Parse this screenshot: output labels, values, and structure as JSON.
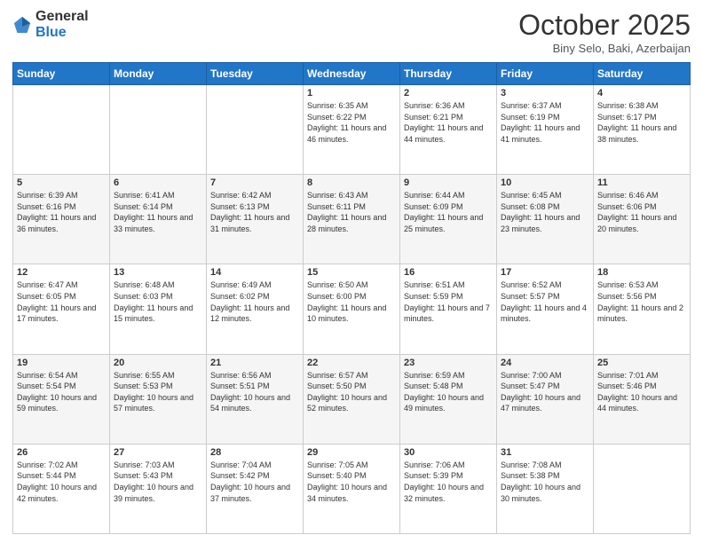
{
  "header": {
    "logo_general": "General",
    "logo_blue": "Blue",
    "month_title": "October 2025",
    "location": "Biny Selo, Baki, Azerbaijan"
  },
  "days_of_week": [
    "Sunday",
    "Monday",
    "Tuesday",
    "Wednesday",
    "Thursday",
    "Friday",
    "Saturday"
  ],
  "weeks": [
    [
      {
        "day": "",
        "info": ""
      },
      {
        "day": "",
        "info": ""
      },
      {
        "day": "",
        "info": ""
      },
      {
        "day": "1",
        "info": "Sunrise: 6:35 AM\nSunset: 6:22 PM\nDaylight: 11 hours and 46 minutes."
      },
      {
        "day": "2",
        "info": "Sunrise: 6:36 AM\nSunset: 6:21 PM\nDaylight: 11 hours and 44 minutes."
      },
      {
        "day": "3",
        "info": "Sunrise: 6:37 AM\nSunset: 6:19 PM\nDaylight: 11 hours and 41 minutes."
      },
      {
        "day": "4",
        "info": "Sunrise: 6:38 AM\nSunset: 6:17 PM\nDaylight: 11 hours and 38 minutes."
      }
    ],
    [
      {
        "day": "5",
        "info": "Sunrise: 6:39 AM\nSunset: 6:16 PM\nDaylight: 11 hours and 36 minutes."
      },
      {
        "day": "6",
        "info": "Sunrise: 6:41 AM\nSunset: 6:14 PM\nDaylight: 11 hours and 33 minutes."
      },
      {
        "day": "7",
        "info": "Sunrise: 6:42 AM\nSunset: 6:13 PM\nDaylight: 11 hours and 31 minutes."
      },
      {
        "day": "8",
        "info": "Sunrise: 6:43 AM\nSunset: 6:11 PM\nDaylight: 11 hours and 28 minutes."
      },
      {
        "day": "9",
        "info": "Sunrise: 6:44 AM\nSunset: 6:09 PM\nDaylight: 11 hours and 25 minutes."
      },
      {
        "day": "10",
        "info": "Sunrise: 6:45 AM\nSunset: 6:08 PM\nDaylight: 11 hours and 23 minutes."
      },
      {
        "day": "11",
        "info": "Sunrise: 6:46 AM\nSunset: 6:06 PM\nDaylight: 11 hours and 20 minutes."
      }
    ],
    [
      {
        "day": "12",
        "info": "Sunrise: 6:47 AM\nSunset: 6:05 PM\nDaylight: 11 hours and 17 minutes."
      },
      {
        "day": "13",
        "info": "Sunrise: 6:48 AM\nSunset: 6:03 PM\nDaylight: 11 hours and 15 minutes."
      },
      {
        "day": "14",
        "info": "Sunrise: 6:49 AM\nSunset: 6:02 PM\nDaylight: 11 hours and 12 minutes."
      },
      {
        "day": "15",
        "info": "Sunrise: 6:50 AM\nSunset: 6:00 PM\nDaylight: 11 hours and 10 minutes."
      },
      {
        "day": "16",
        "info": "Sunrise: 6:51 AM\nSunset: 5:59 PM\nDaylight: 11 hours and 7 minutes."
      },
      {
        "day": "17",
        "info": "Sunrise: 6:52 AM\nSunset: 5:57 PM\nDaylight: 11 hours and 4 minutes."
      },
      {
        "day": "18",
        "info": "Sunrise: 6:53 AM\nSunset: 5:56 PM\nDaylight: 11 hours and 2 minutes."
      }
    ],
    [
      {
        "day": "19",
        "info": "Sunrise: 6:54 AM\nSunset: 5:54 PM\nDaylight: 10 hours and 59 minutes."
      },
      {
        "day": "20",
        "info": "Sunrise: 6:55 AM\nSunset: 5:53 PM\nDaylight: 10 hours and 57 minutes."
      },
      {
        "day": "21",
        "info": "Sunrise: 6:56 AM\nSunset: 5:51 PM\nDaylight: 10 hours and 54 minutes."
      },
      {
        "day": "22",
        "info": "Sunrise: 6:57 AM\nSunset: 5:50 PM\nDaylight: 10 hours and 52 minutes."
      },
      {
        "day": "23",
        "info": "Sunrise: 6:59 AM\nSunset: 5:48 PM\nDaylight: 10 hours and 49 minutes."
      },
      {
        "day": "24",
        "info": "Sunrise: 7:00 AM\nSunset: 5:47 PM\nDaylight: 10 hours and 47 minutes."
      },
      {
        "day": "25",
        "info": "Sunrise: 7:01 AM\nSunset: 5:46 PM\nDaylight: 10 hours and 44 minutes."
      }
    ],
    [
      {
        "day": "26",
        "info": "Sunrise: 7:02 AM\nSunset: 5:44 PM\nDaylight: 10 hours and 42 minutes."
      },
      {
        "day": "27",
        "info": "Sunrise: 7:03 AM\nSunset: 5:43 PM\nDaylight: 10 hours and 39 minutes."
      },
      {
        "day": "28",
        "info": "Sunrise: 7:04 AM\nSunset: 5:42 PM\nDaylight: 10 hours and 37 minutes."
      },
      {
        "day": "29",
        "info": "Sunrise: 7:05 AM\nSunset: 5:40 PM\nDaylight: 10 hours and 34 minutes."
      },
      {
        "day": "30",
        "info": "Sunrise: 7:06 AM\nSunset: 5:39 PM\nDaylight: 10 hours and 32 minutes."
      },
      {
        "day": "31",
        "info": "Sunrise: 7:08 AM\nSunset: 5:38 PM\nDaylight: 10 hours and 30 minutes."
      },
      {
        "day": "",
        "info": ""
      }
    ]
  ]
}
